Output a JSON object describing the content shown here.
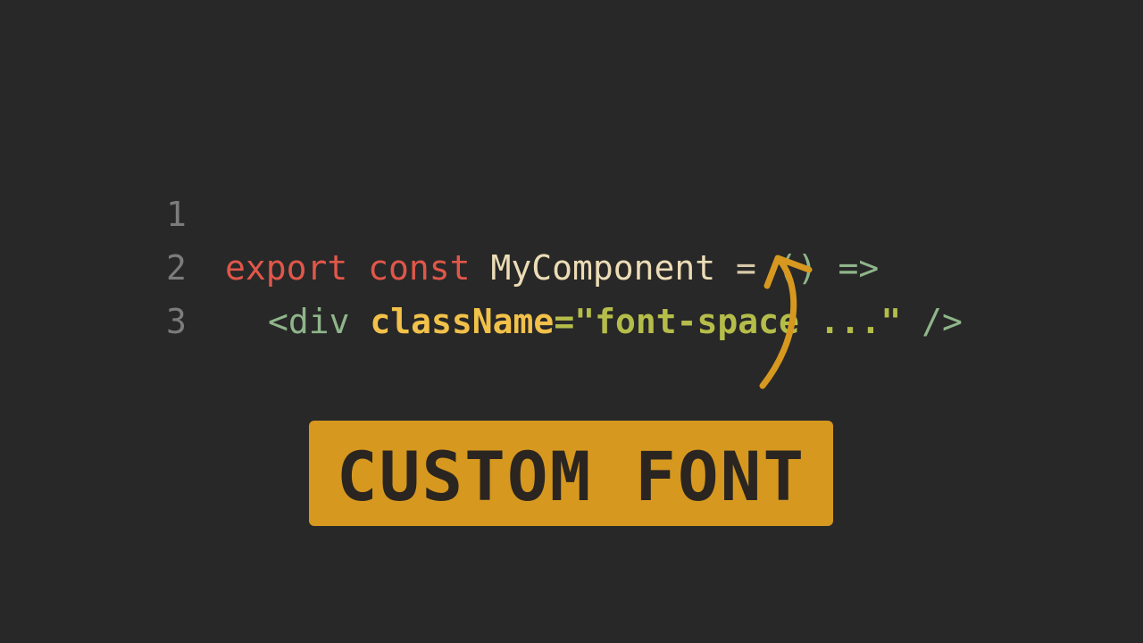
{
  "editor": {
    "lines": [
      {
        "number": "1",
        "tokens": {
          "t1": "export",
          "t2": "const",
          "t3": "MyComponent",
          "t4": "=",
          "t5": "()",
          "t6": "=>"
        }
      },
      {
        "number": "2",
        "tokens": {
          "t1": "<div",
          "t2": "className",
          "t3": "=\"font-space ...\"",
          "t4": "/>"
        }
      },
      {
        "number": "3"
      }
    ]
  },
  "annotation": {
    "label": "CUSTOM FONT",
    "color": "#d6981f",
    "arrow_icon": "curved-up-arrow"
  },
  "colors": {
    "background": "#282828",
    "keyword": "#e0574a",
    "identifier": "#ecdcb6",
    "jsx": "#8fb58a",
    "attribute": "#f2c14a",
    "string": "#b5bd4a",
    "line_number": "#7c7c7c"
  }
}
